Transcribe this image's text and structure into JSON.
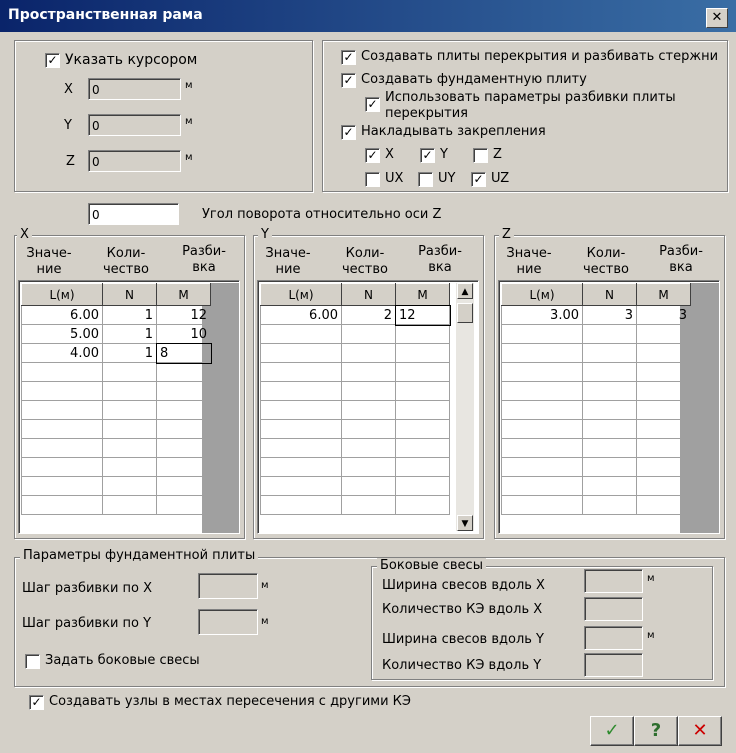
{
  "window": {
    "title": "Пространственная рама"
  },
  "cursor": {
    "label": "Указать курсором",
    "checked": true,
    "fields": [
      {
        "axis": "X",
        "value": "0",
        "unit": "м"
      },
      {
        "axis": "Y",
        "value": "0",
        "unit": "м"
      },
      {
        "axis": "Z",
        "value": "0",
        "unit": "м"
      }
    ]
  },
  "options": {
    "create_slabs": {
      "label": "Создавать плиты перекрытия и разбивать стержни",
      "checked": true
    },
    "create_foundation": {
      "label": "Создавать фундаментную плиту",
      "checked": true
    },
    "use_params": {
      "label": "Использовать параметры разбивки плиты перекрытия",
      "checked": true
    },
    "constraints": {
      "label": "Накладывать закрепления",
      "checked": true
    },
    "dofs": [
      {
        "label": "X",
        "checked": true
      },
      {
        "label": "Y",
        "checked": true
      },
      {
        "label": "Z",
        "checked": false
      },
      {
        "label": "UX",
        "checked": false
      },
      {
        "label": "UY",
        "checked": false
      },
      {
        "label": "UZ",
        "checked": true
      }
    ]
  },
  "rotation": {
    "value": "0",
    "label": "Угол поворота относительно оси Z"
  },
  "grids": [
    {
      "title": "X",
      "col_titles": [
        "Значе-\nние",
        "Коли-\nчество",
        "Разби-\nвка"
      ],
      "headers": [
        "L(м)",
        "N",
        "M"
      ],
      "rows": [
        [
          "6.00",
          "1",
          "12"
        ],
        [
          "5.00",
          "1",
          "10"
        ],
        [
          "4.00",
          "1",
          "8"
        ]
      ]
    },
    {
      "title": "Y",
      "col_titles": [
        "Значе-\nние",
        "Коли-\nчество",
        "Разби-\nвка"
      ],
      "headers": [
        "L(м)",
        "N",
        "M"
      ],
      "rows": [
        [
          "6.00",
          "2",
          "12"
        ]
      ]
    },
    {
      "title": "Z",
      "col_titles": [
        "Значе-\nние",
        "Коли-\nчество",
        "Разби-\nвка"
      ],
      "headers": [
        "L(м)",
        "N",
        "M"
      ],
      "rows": [
        [
          "3.00",
          "3",
          "3"
        ]
      ]
    }
  ],
  "foundation": {
    "title": "Параметры фундаментной плиты",
    "step_x": {
      "label": "Шаг разбивки по X",
      "value": "",
      "unit": "м"
    },
    "step_y": {
      "label": "Шаг разбивки по Y",
      "value": "",
      "unit": "м"
    },
    "side_overhang": {
      "label": "Задать боковые свесы",
      "checked": false
    },
    "overhangs": {
      "title": "Боковые свесы",
      "width_x": {
        "label": "Ширина свесов вдоль X",
        "value": "",
        "unit": "м"
      },
      "count_x": {
        "label": "Количество КЭ вдоль X",
        "value": ""
      },
      "width_y": {
        "label": "Ширина свесов вдоль Y",
        "value": "",
        "unit": "м"
      },
      "count_y": {
        "label": "Количество КЭ вдоль Y",
        "value": ""
      }
    }
  },
  "nodes": {
    "label": "Создавать узлы в местах пересечения с другими КЭ",
    "checked": true
  },
  "buttons": {
    "ok": "✓",
    "help": "?",
    "cancel": "✕"
  },
  "colors": {
    "ok": "#2e8b2e",
    "help": "#2e6e2e",
    "cancel": "#cc0000"
  }
}
